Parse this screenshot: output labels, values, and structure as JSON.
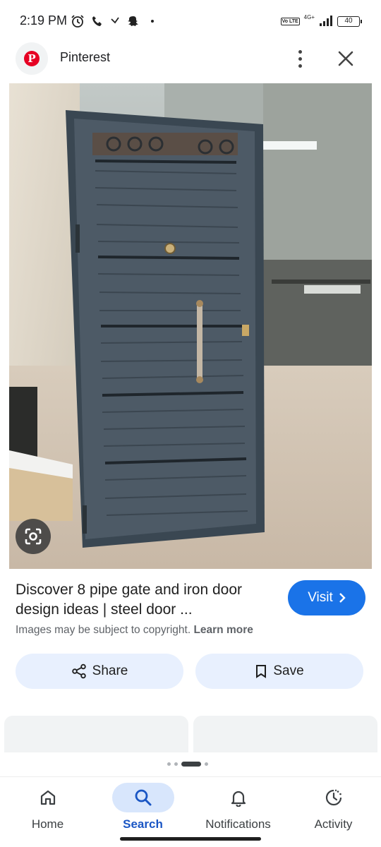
{
  "status_bar": {
    "time": "2:19 PM",
    "network": "4G+",
    "battery": "40",
    "volte": "Vo LTE"
  },
  "header": {
    "site_name": "Pinterest",
    "logo_letter": "P",
    "icons": [
      "more-vert-icon",
      "close-icon"
    ]
  },
  "result": {
    "title": "Discover 8 pipe gate and iron door design ideas | steel door ...",
    "visit_label": "Visit",
    "copyright_text": "Images may be subject to copyright.",
    "learn_more": "Learn more"
  },
  "actions": {
    "share_label": "Share",
    "save_label": "Save"
  },
  "bottom_nav": {
    "items": [
      {
        "label": "Home",
        "icon": "home-icon"
      },
      {
        "label": "Search",
        "icon": "search-icon",
        "active": true
      },
      {
        "label": "Notifications",
        "icon": "bell-icon"
      },
      {
        "label": "Activity",
        "icon": "activity-icon"
      }
    ]
  },
  "colors": {
    "accent": "#1a73e8",
    "pill_bg": "#e8f0fe",
    "pinterest_red": "#e60023",
    "door": "#4d5a66"
  }
}
